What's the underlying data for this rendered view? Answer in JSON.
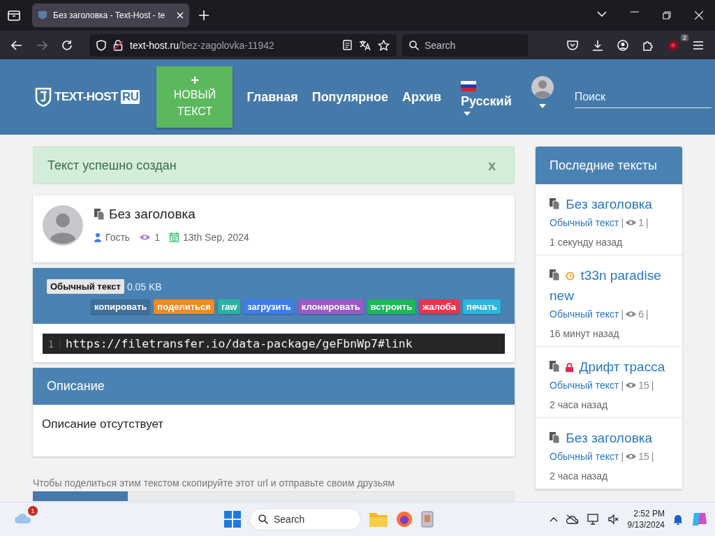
{
  "browser": {
    "tab_title": "Без заголовка - Text-Host - te",
    "url_host": "text-host.ru",
    "url_path": "/bez-zagolovka-11942",
    "search_placeholder": "Search",
    "extension_badge": "2"
  },
  "header": {
    "logo_text": "TEXT-HOST",
    "logo_suffix": "RU",
    "new_button_plus": "+",
    "new_button_label": "НОВЫЙ ТЕКСТ",
    "nav": [
      "Главная",
      "Популярное",
      "Архив"
    ],
    "language": "Русский",
    "search_placeholder": "Поиск"
  },
  "alert": {
    "message": "Текст успешно создан",
    "close": "x"
  },
  "paste": {
    "title": "Без заголовка",
    "author": "Гость",
    "views": "1",
    "date": "13th Sep, 2024"
  },
  "code_panel": {
    "syntax": "Обычный текст",
    "size": "0.05 KB",
    "actions": [
      {
        "label": "копировать",
        "color": "#3f6f9a"
      },
      {
        "label": "поделиться",
        "color": "#f28a1e"
      },
      {
        "label": "raw",
        "color": "#26b5a0"
      },
      {
        "label": "загрузить",
        "color": "#3d7ee6"
      },
      {
        "label": "клонировать",
        "color": "#9b59c8"
      },
      {
        "label": "встроить",
        "color": "#1cb85a"
      },
      {
        "label": "жалоба",
        "color": "#e8344f"
      },
      {
        "label": "печать",
        "color": "#2cb5e0"
      }
    ],
    "lines": [
      {
        "number": "1",
        "text": "https://filetransfer.io/data-package/geFbnWp7#link"
      }
    ]
  },
  "description": {
    "heading": "Описание",
    "body": "Описание отсутствует"
  },
  "share_hint": "Чтобы поделиться этим текстом скопируйте этот url и отправьте своим друзьям",
  "sidebar": {
    "heading": "Последние тексты",
    "items": [
      {
        "title": "Без заголовка",
        "kind": "plain",
        "syntax": "Обычный текст",
        "views": "1",
        "separators": [
          "|",
          "|"
        ],
        "time": "1 секунду назад"
      },
      {
        "title": "t33n paradise new",
        "kind": "expiring",
        "syntax": "Обычный текст",
        "views": "6",
        "separators": [
          "|",
          "|"
        ],
        "time": "16 минут назад"
      },
      {
        "title": "Дрифт трасса",
        "kind": "private",
        "syntax": "Обычный текст",
        "views": "15",
        "separators": [
          "|",
          "|"
        ],
        "time": "2 часа назад"
      },
      {
        "title": "Без заголовка",
        "kind": "plain",
        "syntax": "Обычный текст",
        "views": "15",
        "separators": [
          "|",
          "|"
        ],
        "time": "2 часа назад"
      }
    ]
  },
  "taskbar": {
    "weather_badge": "1",
    "search_placeholder": "Search",
    "time": "2:52 PM",
    "date": "9/13/2024"
  }
}
